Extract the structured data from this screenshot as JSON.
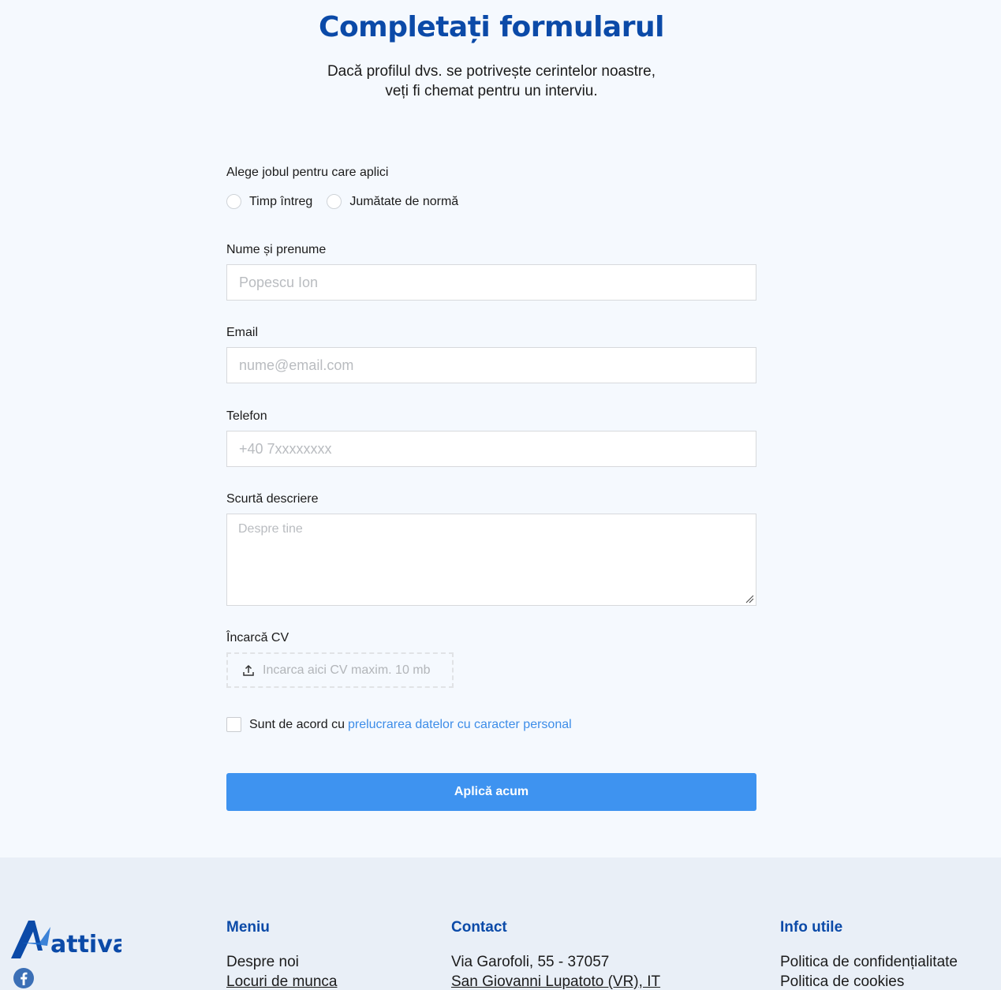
{
  "header": {
    "title": "Completați formularul",
    "subtitle": "Dacă profilul dvs. se potrivește cerintelor noastre, veți fi chemat pentru un interviu."
  },
  "form": {
    "job_type_label": "Alege jobul pentru care aplici",
    "job_options": [
      "Timp întreg",
      "Jumătate de normă"
    ],
    "name_label": "Nume și prenume",
    "name_placeholder": "Popescu Ion",
    "email_label": "Email",
    "email_placeholder": "nume@email.com",
    "phone_label": "Telefon",
    "phone_placeholder": "+40 7xxxxxxxx",
    "description_label": "Scurtă descriere",
    "description_placeholder": "Despre tine",
    "cv_label": "Încarcă CV",
    "cv_upload_text": "Incarca aici CV maxim. 10 mb",
    "consent_text": "Sunt de acord cu",
    "consent_link": "prelucrarea datelor cu caracter personal",
    "submit_label": "Aplică acum"
  },
  "footer": {
    "logo_text": "attiva",
    "menu": {
      "heading": "Meniu",
      "items": [
        "Despre noi",
        "Locuri de munca"
      ]
    },
    "contact": {
      "heading": "Contact",
      "items": [
        "Via Garofoli, 55 - 37057",
        "San Giovanni Lupatoto (VR), IT"
      ]
    },
    "info": {
      "heading": "Info utile",
      "items": [
        "Politica de confidențialitate",
        "Politica de cookies"
      ]
    }
  },
  "colors": {
    "page_bg": "#f5f9fe",
    "heading_blue": "#0b4aa8",
    "button_blue": "#3e93f0",
    "link_blue": "#3d8de8",
    "footer_bg": "#e9eff7"
  },
  "icons": [
    "upload-icon",
    "facebook-icon",
    "resize-grip-icon"
  ]
}
